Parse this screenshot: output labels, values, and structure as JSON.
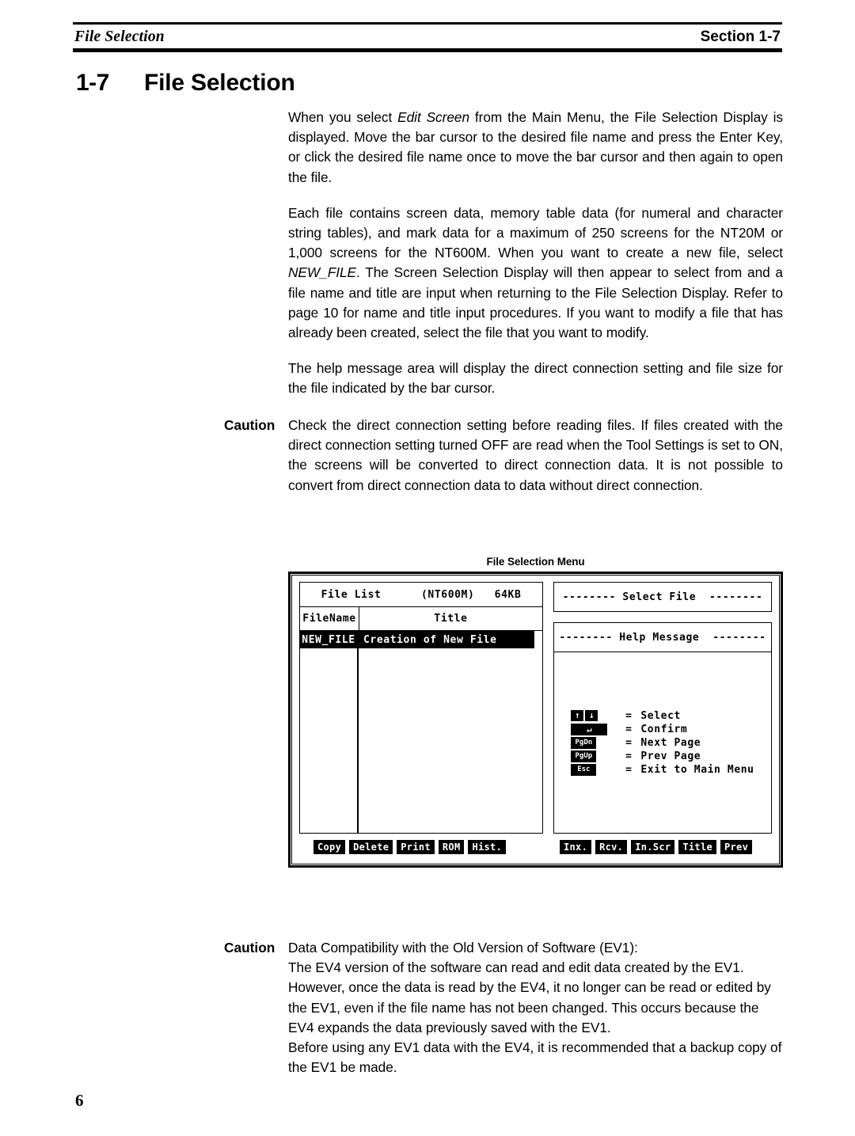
{
  "header": {
    "left_title": "File Selection",
    "right_title": "Section 1-7"
  },
  "section": {
    "number": "1-7",
    "title": "File Selection"
  },
  "body_paragraphs": {
    "p1_part1": "When you select ",
    "p1_em": "Edit Screen",
    "p1_part2": " from the Main Menu, the File Selection Display is displayed. Move the bar cursor to the desired file name and press the Enter Key, or click the desired file name once to move the bar cursor and then again to open the file.",
    "p2_part1": "Each file contains screen data, memory table data (for numeral and character string tables), and mark data for a maximum of 250 screens for the NT20M or 1,000 screens for the NT600M. When you want to create a new file, select ",
    "p2_em": "NEW_FILE",
    "p2_part2": ". The Screen Selection Display will then appear to select from and a file name and title are input when returning to the File Selection Display. Refer to page 10 for name and title input procedures. If you want to modify a file that has already been created, select the file that you want to modify.",
    "p3": "The help message area will display the direct connection setting and file size for the file indicated by the bar cursor."
  },
  "caution_direct_connection": {
    "label": "Caution",
    "text": "Check the direct connection setting before reading files. If files created with the direct connection setting turned OFF are read when the Tool Settings is set to ON, the screens will be converted to direct connection data. It is not possible to convert from direct connection data to data without direct connection."
  },
  "caution_data_compat": {
    "label": "Caution",
    "line1": "Data Compatibility with the Old Version of Software (EV1):",
    "line2": "The EV4 version of the software can read and edit data created by the EV1.",
    "line3": "However, once the data is read by the EV4, it no longer can be read or edited by the EV1, even if the file name has not been changed. This occurs because the EV4 expands the data previously saved with the EV1.",
    "line4": "Before using any EV1 data with the EV4, it is recommended that a backup copy of the EV1 be made."
  },
  "figure": {
    "caption": "File Selection Menu",
    "file_list": {
      "header": "File List      (NT600M)   64KB",
      "title_label": "File List",
      "model": "(NT600M)",
      "size": "64KB",
      "columns": {
        "filename": "FileName",
        "title": "Title"
      },
      "rows": [
        {
          "filename": "NEW_FILE",
          "title": "Creation of New File",
          "selected": true
        }
      ]
    },
    "select_file_panel": {
      "title": "-------- Select File  --------"
    },
    "help_panel": {
      "title": "-------- Help Message  --------",
      "keys": [
        {
          "key_type": "arrows",
          "cap_up": "↑",
          "cap_down": "↓",
          "equals": "=",
          "action": "Select"
        },
        {
          "key_type": "enter",
          "cap": "↵",
          "equals": "=",
          "action": "Confirm"
        },
        {
          "key_type": "cap",
          "cap": "PgDn",
          "equals": "=",
          "action": "Next Page"
        },
        {
          "key_type": "cap",
          "cap": "PgUp",
          "equals": "=",
          "action": "Prev Page"
        },
        {
          "key_type": "cap",
          "cap": "Esc",
          "equals": "=",
          "action": "Exit to Main Menu"
        }
      ]
    },
    "buttons_left": [
      "Copy",
      "Delete",
      "Print",
      "ROM",
      "Hist."
    ],
    "buttons_right": [
      "Inx.",
      "Rcv.",
      "In.Scr",
      "Title",
      "Prev"
    ]
  },
  "footer": {
    "page_number": "6"
  }
}
